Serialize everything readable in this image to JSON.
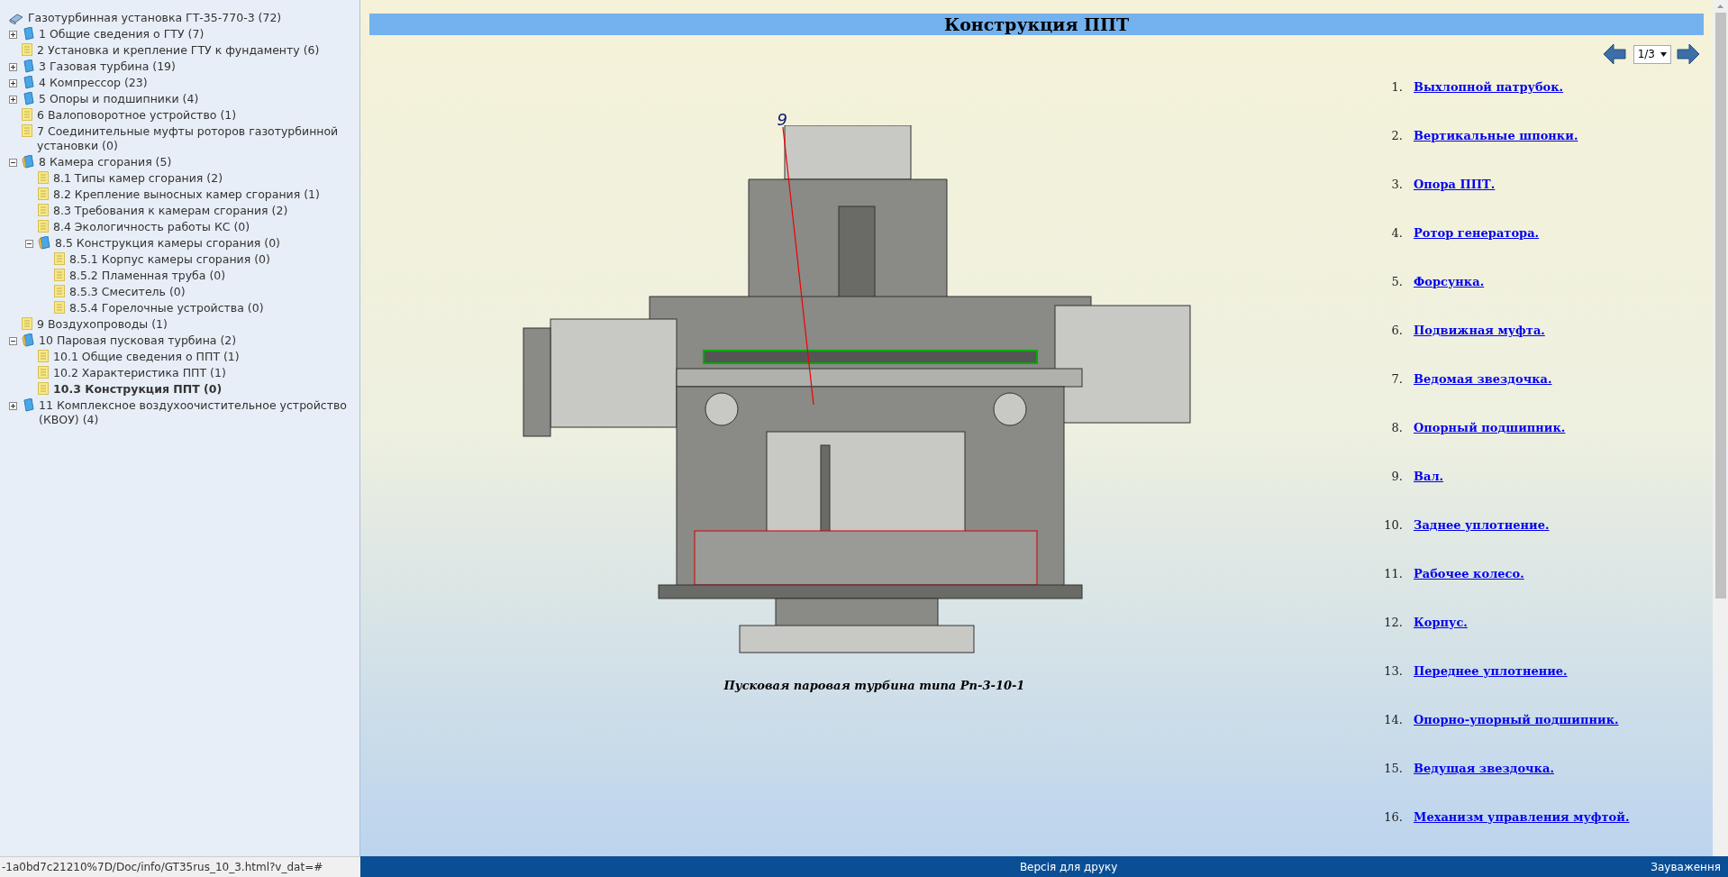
{
  "tree": {
    "label": "Газотурбинная установка ГТ-35-770-3 (72)",
    "kind": "root",
    "children": [
      {
        "label": "1 Общие сведения о ГТУ (7)",
        "kind": "folder",
        "expanded": false
      },
      {
        "label": "2 Установка и крепление ГТУ к фундаменту (6)",
        "kind": "page",
        "selected": false
      },
      {
        "label": "3 Газовая турбина (19)",
        "kind": "folder",
        "expanded": false
      },
      {
        "label": "4 Компрессор (23)",
        "kind": "folder",
        "expanded": false
      },
      {
        "label": "5 Опоры и подшипники (4)",
        "kind": "folder",
        "expanded": false
      },
      {
        "label": "6 Валоповоротное устройство (1)",
        "kind": "page",
        "selected": false
      },
      {
        "label": "7 Соединительные муфты роторов газотурбинной установки (0)",
        "kind": "page",
        "selected": false
      },
      {
        "label": "8 Камера сгорания (5)",
        "kind": "folder",
        "expanded": true,
        "children": [
          {
            "label": "8.1 Типы камер сгорания (2)",
            "kind": "page",
            "selected": false
          },
          {
            "label": "8.2 Крепление выносных камер сгорания (1)",
            "kind": "page",
            "selected": false
          },
          {
            "label": "8.3 Требования к камерам сгорания (2)",
            "kind": "page",
            "selected": false
          },
          {
            "label": "8.4 Экологичность работы КС (0)",
            "kind": "page",
            "selected": false
          },
          {
            "label": "8.5 Конструкция камеры сгорания (0)",
            "kind": "folder",
            "expanded": true,
            "children": [
              {
                "label": "8.5.1 Корпус камеры сгорания (0)",
                "kind": "page",
                "selected": false
              },
              {
                "label": "8.5.2 Пламенная труба (0)",
                "kind": "page",
                "selected": false
              },
              {
                "label": "8.5.3 Смеситель (0)",
                "kind": "page",
                "selected": false
              },
              {
                "label": "8.5.4 Горелочные устройства (0)",
                "kind": "page",
                "selected": false
              }
            ]
          }
        ]
      },
      {
        "label": "9 Воздухопроводы (1)",
        "kind": "page",
        "selected": false
      },
      {
        "label": "10 Паровая пусковая турбина (2)",
        "kind": "folder",
        "expanded": true,
        "children": [
          {
            "label": "10.1 Общие сведения о ППТ (1)",
            "kind": "page",
            "selected": false
          },
          {
            "label": "10.2 Характеристика ППТ (1)",
            "kind": "page",
            "selected": false
          },
          {
            "label": "10.3 Конструкция ППТ (0)",
            "kind": "page",
            "selected": true
          }
        ]
      },
      {
        "label": "11 Комплексное воздухоочистительное устройство (КВОУ) (4)",
        "kind": "folder",
        "expanded": false
      }
    ]
  },
  "page_title": "Конструкция ППТ",
  "pager": {
    "value": "1/3"
  },
  "figure": {
    "callout": "9",
    "caption": "Пусковая паровая турбина типа Рп-3-10-1"
  },
  "parts": [
    {
      "number": "1.",
      "label": "Выхлопной патрубок."
    },
    {
      "number": "2.",
      "label": "Вертикальные шпонки."
    },
    {
      "number": "3.",
      "label": "Опора ППТ."
    },
    {
      "number": "4.",
      "label": "Ротор генератора."
    },
    {
      "number": "5.",
      "label": "Форсунка."
    },
    {
      "number": "6.",
      "label": "Подвижная муфта."
    },
    {
      "number": "7.",
      "label": "Ведомая звездочка."
    },
    {
      "number": "8.",
      "label": "Опорный подшипник."
    },
    {
      "number": "9.",
      "label": "Вал."
    },
    {
      "number": "10.",
      "label": "Заднее уплотнение."
    },
    {
      "number": "11.",
      "label": "Рабочее колесо."
    },
    {
      "number": "12.",
      "label": "Корпус."
    },
    {
      "number": "13.",
      "label": "Переднее уплотнение."
    },
    {
      "number": "14.",
      "label": "Опорно-упорный подшипник."
    },
    {
      "number": "15.",
      "label": "Ведущая звездочка."
    },
    {
      "number": "16.",
      "label": "Механизм управления муфтой."
    }
  ],
  "status_bar": {
    "url": "-1a0bd7c21210%7D/Doc/info/GT35rus_10_3.html?v_dat=#",
    "print": "Версія для друку",
    "feedback": "Зауваження"
  }
}
